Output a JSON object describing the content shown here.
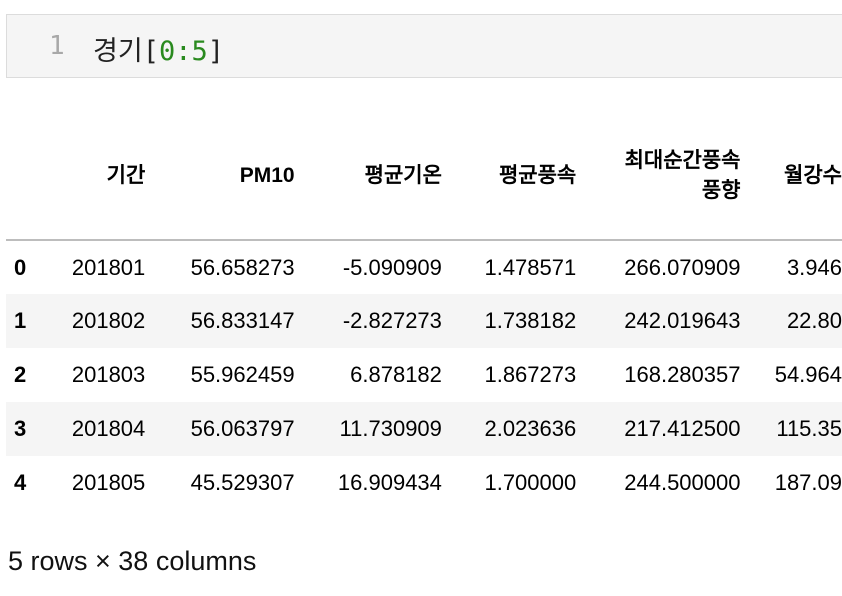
{
  "cell": {
    "line_number": "1",
    "code_var": "경기",
    "code_open": "[",
    "code_start": "0",
    "code_colon": ":",
    "code_end": "5",
    "code_close": "]"
  },
  "table": {
    "columns": [
      "",
      "기간",
      "PM10",
      "평균기온",
      "평균풍속",
      "최대순간풍속\n풍향",
      "월강수"
    ],
    "rows": [
      [
        "0",
        "201801",
        "56.658273",
        "-5.090909",
        "1.478571",
        "266.070909",
        "3.946"
      ],
      [
        "1",
        "201802",
        "56.833147",
        "-2.827273",
        "1.738182",
        "242.019643",
        "22.80"
      ],
      [
        "2",
        "201803",
        "55.962459",
        "6.878182",
        "1.867273",
        "168.280357",
        "54.964"
      ],
      [
        "3",
        "201804",
        "56.063797",
        "11.730909",
        "2.023636",
        "217.412500",
        "115.35"
      ],
      [
        "4",
        "201805",
        "45.529307",
        "16.909434",
        "1.700000",
        "244.500000",
        "187.09"
      ]
    ]
  },
  "summary": "5 rows × 38 columns"
}
